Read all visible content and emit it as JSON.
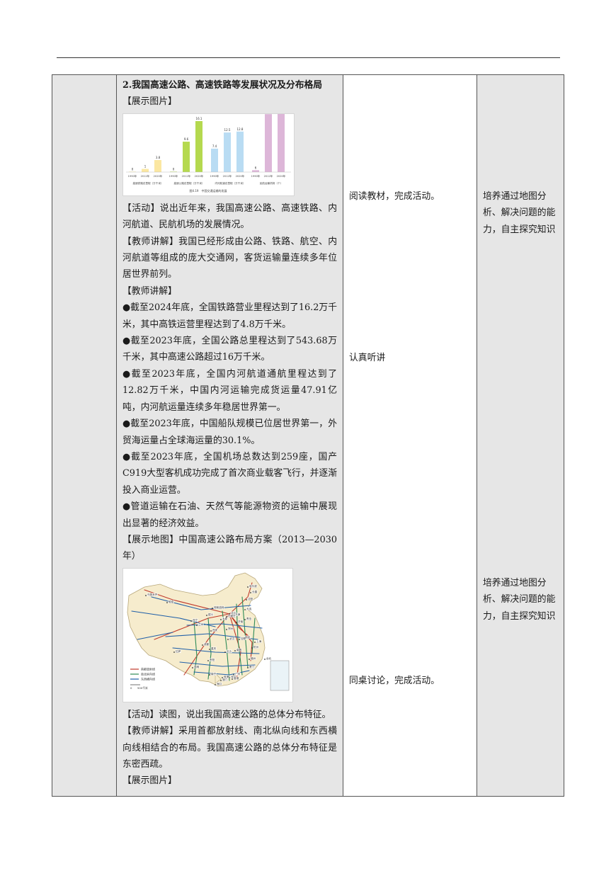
{
  "section_title": "2.我国高速公路、高速铁路等发展状况及分布格局",
  "tag_show_image": "【展示图片】",
  "bar_figure": {
    "caption": "图4.19　中国交通运输的发展",
    "groups": [
      {
        "label": "高速铁路总里程（万千米）",
        "color": "#fbe7a2",
        "bars": [
          {
            "year": "1990年",
            "value": 0,
            "value_label": "0"
          },
          {
            "year": "2012年",
            "value": 1,
            "value_label": "1"
          },
          {
            "year": "2020年",
            "value": 3.8,
            "value_label": "3.8"
          }
        ]
      },
      {
        "label": "高速公路总里程（万千米）",
        "color": "#b5d94f",
        "bars": [
          {
            "year": "1990年",
            "value": 0,
            "value_label": "0"
          },
          {
            "year": "2012年",
            "value": 9.6,
            "value_label": "9.6"
          },
          {
            "year": "2020年",
            "value": 16.1,
            "value_label": "16.1"
          }
        ]
      },
      {
        "label": "内河航道总里程（万千米）",
        "color": "#b9dcf3",
        "bars": [
          {
            "year": "1990年",
            "value": 7.4,
            "value_label": "7.4"
          },
          {
            "year": "2012年",
            "value": 12.5,
            "value_label": "12.5"
          },
          {
            "year": "2020年",
            "value": 12.8,
            "value_label": "12.8"
          }
        ]
      },
      {
        "label": "民航运输机场（个）",
        "color": "#ddb6d8",
        "bars": [
          {
            "year": "1990年",
            "value": 0.6,
            "value_label": "6"
          },
          {
            "year": "2012年",
            "value": 18.3,
            "value_label": "183"
          },
          {
            "year": "2020年",
            "value": 24.1,
            "value_label": "241"
          }
        ]
      }
    ]
  },
  "activity_1": "【活动】说出近年来，我国高速公路、高速铁路、内河航道、民航机场的发展情况。",
  "teacher_1": "【教师讲解】我国已经形成由公路、铁路、航空、内河航道等组成的庞大交通网，客货运输量连续多年位居世界前列。",
  "teacher_2_tag": "【教师讲解】",
  "facts": [
    "●截至2024年底，全国铁路营业里程达到了16.2万千米，其中高铁运营里程达到了4.8万千米。",
    "●截至2023年底，全国公路总里程达到了543.68万千米，其中高速公路超过16万千米。",
    "●截至2023年底，全国内河航道通航里程达到了12.82万千米，中国内河运输完成货运量47.91亿吨，内河航运量连续多年稳居世界第一。",
    "●截至2023年底，中国船队规模已位居世界第一，外贸海运量占全球海运量的30.1%。",
    "●截至2023年底，全国机场总数达到259座，国产C919大型客机成功完成了首次商业载客飞行，并逐渐投入商业运营。",
    "●管道运输在石油、天然气等能源物资的运输中展现出显著的经济效益。"
  ],
  "map_tag": "【展示地图】中国高速公路布局方案（2013—2030年）",
  "map_legend": {
    "items": [
      {
        "label": "首都放射线",
        "color": "#c0392b"
      },
      {
        "label": "南北纵向线",
        "color": "#2e8b57"
      },
      {
        "label": "东西横向线",
        "color": "#1f5fa8"
      }
    ],
    "scale": "0　　500千米"
  },
  "map_cities": [
    "乌鲁木齐",
    "哈密",
    "拉萨",
    "北京",
    "上海",
    "广州",
    "成都",
    "武汉",
    "西安",
    "兰州",
    "哈尔滨",
    "沈阳",
    "郑州",
    "重庆",
    "昆明",
    "南宁",
    "福州",
    "杭州",
    "济南",
    "天津",
    "长沙",
    "南京",
    "贵阳",
    "太原",
    "银川",
    "西宁",
    "呼和浩特",
    "长春",
    "海口",
    "台北",
    "厦门",
    "青岛",
    "大连",
    "合肥",
    "南昌",
    "石家庄",
    "深圳",
    "香港",
    "澳门",
    "珠海"
  ],
  "activity_2": "【活动】读图，说出我国高速公路的总体分布特征。",
  "teacher_3": "【教师讲解】采用首都放射线、南北纵向线和东西横向线相结合的布局。我国高速公路的总体分布特征是东密西疏。",
  "tag_show_image_2": "【展示图片】",
  "student_1": "阅读教材，完成活动。",
  "student_2": "认真听讲",
  "student_3": "同桌讨论，完成活动。",
  "intent_1": "培养通过地图分析、解决问题的能力，自主探究知识",
  "intent_2": "培养通过地图分析、解决问题的能力，自主探究知识"
}
